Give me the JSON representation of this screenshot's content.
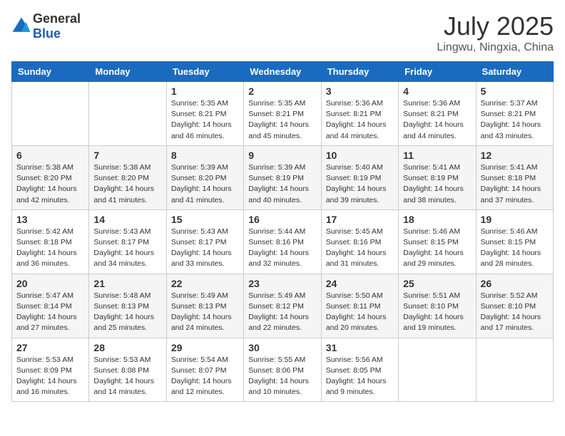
{
  "header": {
    "logo_general": "General",
    "logo_blue": "Blue",
    "month_year": "July 2025",
    "location": "Lingwu, Ningxia, China"
  },
  "weekdays": [
    "Sunday",
    "Monday",
    "Tuesday",
    "Wednesday",
    "Thursday",
    "Friday",
    "Saturday"
  ],
  "weeks": [
    [
      {
        "day": "",
        "info": ""
      },
      {
        "day": "",
        "info": ""
      },
      {
        "day": "1",
        "info": "Sunrise: 5:35 AM\nSunset: 8:21 PM\nDaylight: 14 hours and 46 minutes."
      },
      {
        "day": "2",
        "info": "Sunrise: 5:35 AM\nSunset: 8:21 PM\nDaylight: 14 hours and 45 minutes."
      },
      {
        "day": "3",
        "info": "Sunrise: 5:36 AM\nSunset: 8:21 PM\nDaylight: 14 hours and 44 minutes."
      },
      {
        "day": "4",
        "info": "Sunrise: 5:36 AM\nSunset: 8:21 PM\nDaylight: 14 hours and 44 minutes."
      },
      {
        "day": "5",
        "info": "Sunrise: 5:37 AM\nSunset: 8:21 PM\nDaylight: 14 hours and 43 minutes."
      }
    ],
    [
      {
        "day": "6",
        "info": "Sunrise: 5:38 AM\nSunset: 8:20 PM\nDaylight: 14 hours and 42 minutes."
      },
      {
        "day": "7",
        "info": "Sunrise: 5:38 AM\nSunset: 8:20 PM\nDaylight: 14 hours and 41 minutes."
      },
      {
        "day": "8",
        "info": "Sunrise: 5:39 AM\nSunset: 8:20 PM\nDaylight: 14 hours and 41 minutes."
      },
      {
        "day": "9",
        "info": "Sunrise: 5:39 AM\nSunset: 8:19 PM\nDaylight: 14 hours and 40 minutes."
      },
      {
        "day": "10",
        "info": "Sunrise: 5:40 AM\nSunset: 8:19 PM\nDaylight: 14 hours and 39 minutes."
      },
      {
        "day": "11",
        "info": "Sunrise: 5:41 AM\nSunset: 8:19 PM\nDaylight: 14 hours and 38 minutes."
      },
      {
        "day": "12",
        "info": "Sunrise: 5:41 AM\nSunset: 8:18 PM\nDaylight: 14 hours and 37 minutes."
      }
    ],
    [
      {
        "day": "13",
        "info": "Sunrise: 5:42 AM\nSunset: 8:18 PM\nDaylight: 14 hours and 36 minutes."
      },
      {
        "day": "14",
        "info": "Sunrise: 5:43 AM\nSunset: 8:17 PM\nDaylight: 14 hours and 34 minutes."
      },
      {
        "day": "15",
        "info": "Sunrise: 5:43 AM\nSunset: 8:17 PM\nDaylight: 14 hours and 33 minutes."
      },
      {
        "day": "16",
        "info": "Sunrise: 5:44 AM\nSunset: 8:16 PM\nDaylight: 14 hours and 32 minutes."
      },
      {
        "day": "17",
        "info": "Sunrise: 5:45 AM\nSunset: 8:16 PM\nDaylight: 14 hours and 31 minutes."
      },
      {
        "day": "18",
        "info": "Sunrise: 5:46 AM\nSunset: 8:15 PM\nDaylight: 14 hours and 29 minutes."
      },
      {
        "day": "19",
        "info": "Sunrise: 5:46 AM\nSunset: 8:15 PM\nDaylight: 14 hours and 28 minutes."
      }
    ],
    [
      {
        "day": "20",
        "info": "Sunrise: 5:47 AM\nSunset: 8:14 PM\nDaylight: 14 hours and 27 minutes."
      },
      {
        "day": "21",
        "info": "Sunrise: 5:48 AM\nSunset: 8:13 PM\nDaylight: 14 hours and 25 minutes."
      },
      {
        "day": "22",
        "info": "Sunrise: 5:49 AM\nSunset: 8:13 PM\nDaylight: 14 hours and 24 minutes."
      },
      {
        "day": "23",
        "info": "Sunrise: 5:49 AM\nSunset: 8:12 PM\nDaylight: 14 hours and 22 minutes."
      },
      {
        "day": "24",
        "info": "Sunrise: 5:50 AM\nSunset: 8:11 PM\nDaylight: 14 hours and 20 minutes."
      },
      {
        "day": "25",
        "info": "Sunrise: 5:51 AM\nSunset: 8:10 PM\nDaylight: 14 hours and 19 minutes."
      },
      {
        "day": "26",
        "info": "Sunrise: 5:52 AM\nSunset: 8:10 PM\nDaylight: 14 hours and 17 minutes."
      }
    ],
    [
      {
        "day": "27",
        "info": "Sunrise: 5:53 AM\nSunset: 8:09 PM\nDaylight: 14 hours and 16 minutes."
      },
      {
        "day": "28",
        "info": "Sunrise: 5:53 AM\nSunset: 8:08 PM\nDaylight: 14 hours and 14 minutes."
      },
      {
        "day": "29",
        "info": "Sunrise: 5:54 AM\nSunset: 8:07 PM\nDaylight: 14 hours and 12 minutes."
      },
      {
        "day": "30",
        "info": "Sunrise: 5:55 AM\nSunset: 8:06 PM\nDaylight: 14 hours and 10 minutes."
      },
      {
        "day": "31",
        "info": "Sunrise: 5:56 AM\nSunset: 8:05 PM\nDaylight: 14 hours and 9 minutes."
      },
      {
        "day": "",
        "info": ""
      },
      {
        "day": "",
        "info": ""
      }
    ]
  ]
}
